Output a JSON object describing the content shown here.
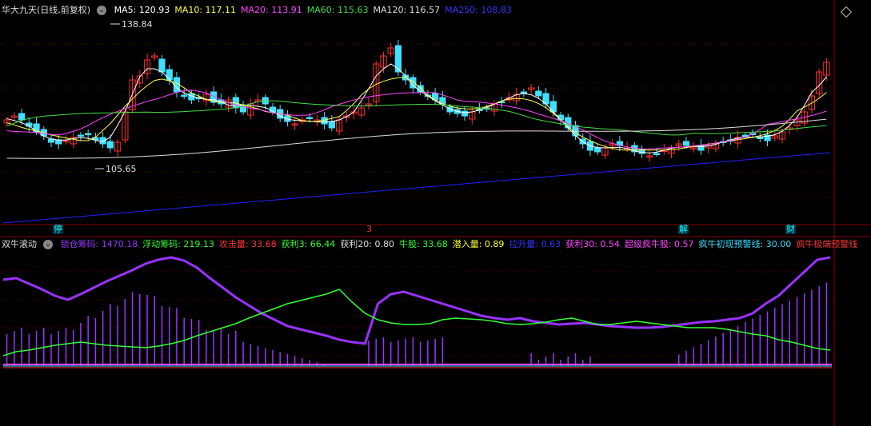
{
  "stock_title": "华大九天(日线,前复权)",
  "main_ma": [
    {
      "label": "MA5: 120.93",
      "color": "#ffffff"
    },
    {
      "label": "MA10: 117.11",
      "color": "#ffff44"
    },
    {
      "label": "MA20: 113.91",
      "color": "#ff44ff"
    },
    {
      "label": "MA60: 115.63",
      "color": "#44dd44"
    },
    {
      "label": "MA120: 116.57",
      "color": "#dddddd"
    },
    {
      "label": "MA250: 108.83",
      "color": "#3333ff"
    }
  ],
  "price_high_label": "138.84",
  "price_low_label": "105.65",
  "event_markers": [
    {
      "text": "停",
      "color": "#00ffff",
      "bg": "#003040"
    },
    {
      "text": "3",
      "color": "#ff3030",
      "bg": "#000"
    },
    {
      "text": "解",
      "color": "#00ffff",
      "bg": "#003040"
    },
    {
      "text": "财",
      "color": "#00ffff",
      "bg": "#003040"
    }
  ],
  "indicator_name": "双牛滚动",
  "indicator_values": [
    {
      "label": "锁仓筹码: 1470.18",
      "color": "#9933ff"
    },
    {
      "label": "浮动筹码: 219.13",
      "color": "#33ff33"
    },
    {
      "label": "攻击量: 33.68",
      "color": "#ff3333"
    },
    {
      "label": "获利3: 66.44",
      "color": "#33ff33"
    },
    {
      "label": "获利20: 0.80",
      "color": "#dddddd"
    },
    {
      "label": "牛股: 33.68",
      "color": "#33ff33"
    },
    {
      "label": "潜入量: 0.89",
      "color": "#ffff33"
    },
    {
      "label": "拉升量: 0.63",
      "color": "#3333ff"
    },
    {
      "label": "获利30: 0.54",
      "color": "#ff44ff"
    },
    {
      "label": "超级疯牛股: 0.57",
      "color": "#ff44ff"
    },
    {
      "label": "疯牛初现预警线: 30.00",
      "color": "#33ddff"
    },
    {
      "label": "疯牛极端预警线",
      "color": "#ff3333"
    }
  ]
}
